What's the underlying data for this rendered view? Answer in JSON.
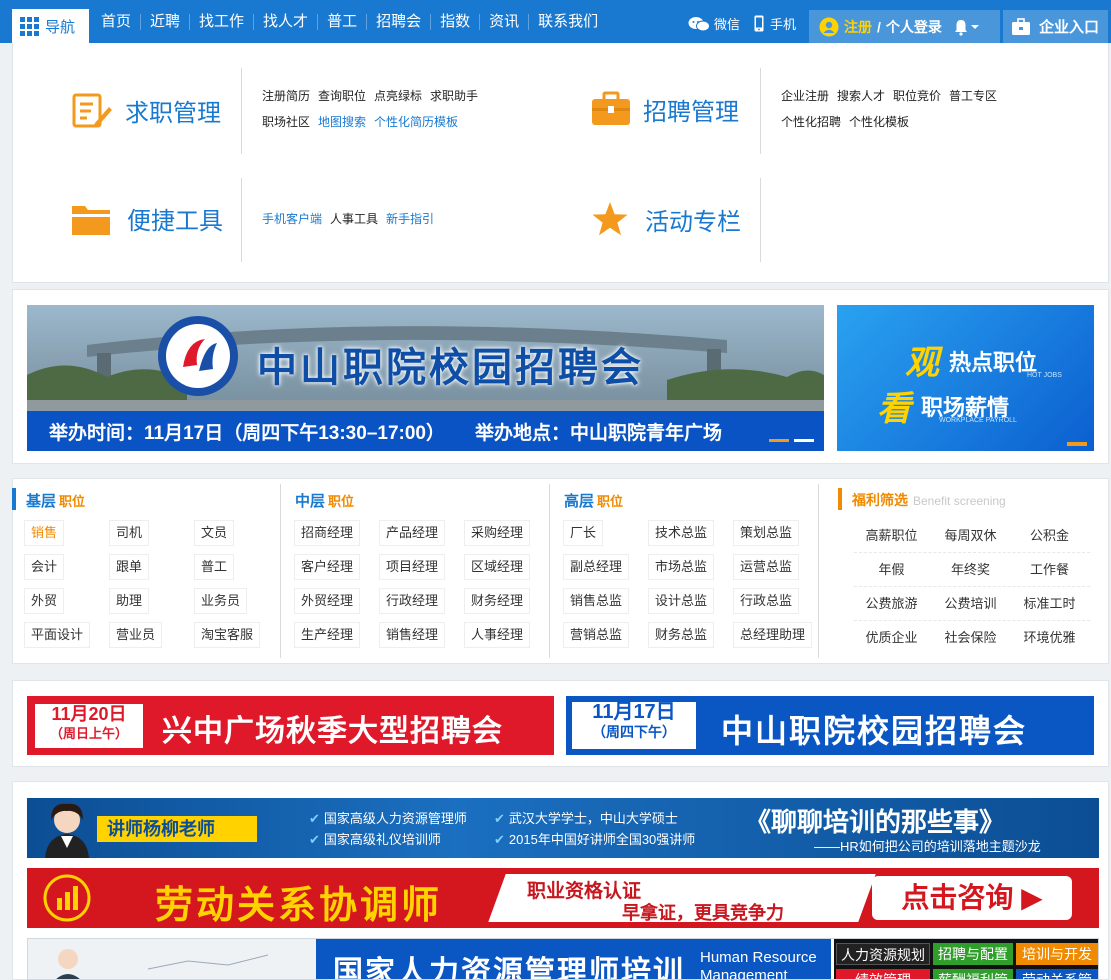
{
  "nav": {
    "menu_label": "导航",
    "items": [
      "首页",
      "近聘",
      "找工作",
      "找人才",
      "普工",
      "招聘会",
      "指数",
      "资讯",
      "联系我们"
    ],
    "wechat": "微信",
    "mobile": "手机",
    "register": "注册",
    "sep": "/",
    "login": "个人登录",
    "enterprise": "企业入口"
  },
  "panel": {
    "job_mgmt": {
      "title": "求职管理",
      "links_row1": [
        "注册简历",
        "查询职位",
        "点亮绿标",
        "求职助手"
      ],
      "links_row2": [
        "职场社区",
        "地图搜索",
        "个性化简历模板"
      ]
    },
    "recruit_mgmt": {
      "title": "招聘管理",
      "links_row1": [
        "企业注册",
        "搜索人才",
        "职位竞价",
        "普工专区"
      ],
      "links_row2": [
        "个性化招聘",
        "个性化模板"
      ]
    },
    "tools": {
      "title": "便捷工具",
      "links": [
        "手机客户端",
        "人事工具",
        "新手指引"
      ]
    },
    "events": {
      "title": "活动专栏"
    }
  },
  "banner": {
    "title": "中山职院校园招聘会",
    "time": "举办时间：11月17日（周四下午13:30–17:00）",
    "place": "举办地点：中山职院青年广场",
    "hot_title": "热点职位",
    "hot_sub": "HOT JOBS",
    "hot_char": "观",
    "news_title": "职场薪情",
    "news_sub": "WORKPLACE PAYROLL",
    "news_char": "看"
  },
  "jobs": {
    "basic": {
      "title": "基层",
      "suffix": "职位",
      "items": [
        "销售",
        "司机",
        "文员",
        "会计",
        "跟单",
        "普工",
        "外贸",
        "助理",
        "业务员",
        "平面设计",
        "营业员",
        "淘宝客服"
      ]
    },
    "middle": {
      "title": "中层",
      "suffix": "职位",
      "items": [
        "招商经理",
        "产品经理",
        "采购经理",
        "客户经理",
        "项目经理",
        "区域经理",
        "外贸经理",
        "行政经理",
        "财务经理",
        "生产经理",
        "销售经理",
        "人事经理"
      ]
    },
    "senior": {
      "title": "高层",
      "suffix": "职位",
      "items": [
        "厂长",
        "技术总监",
        "策划总监",
        "副总经理",
        "市场总监",
        "运营总监",
        "销售总监",
        "设计总监",
        "行政总监",
        "营销总监",
        "财务总监",
        "总经理助理"
      ]
    },
    "benefits": {
      "title": "福利筛选",
      "subtitle": "Benefit screening",
      "items": [
        "高薪职位",
        "每周双休",
        "公积金",
        "年假",
        "年终奖",
        "工作餐",
        "公费旅游",
        "公费培训",
        "标准工时",
        "优质企业",
        "社会保险",
        "环境优雅"
      ]
    }
  },
  "ads": {
    "ad1_date": "11月20日",
    "ad1_day": "（周日上午）",
    "ad1_title": "兴中广场秋季大型招聘会",
    "ad2_date": "11月17日",
    "ad2_day": "（周四下午）",
    "ad2_title": "中山职院校园招聘会",
    "trainer_name": "讲师杨柳老师",
    "trainer_q1": "国家高级人力资源管理师",
    "trainer_q2": "国家高级礼仪培训师",
    "trainer_q3": "武汉大学学士，中山大学硕士",
    "trainer_q4": "2015年中国好讲师全国30强讲师",
    "trainer_title": "《聊聊培训的那些事》",
    "trainer_sub": "——HR如何把公司的培训落地主题沙龙",
    "labor_title": "劳动关系协调师",
    "labor_slogan1": "职业资格认证",
    "labor_slogan2": "早拿证，更具竞争力",
    "labor_btn": "点击咨询 ▶",
    "hr_title": "国家人力资源管理师培训",
    "hr_en": "Human Resource Management",
    "hr_tags": [
      "人力资源规划",
      "招聘与配置",
      "培训与开发",
      "绩效管理",
      "薪酬福利管理",
      "劳动关系管理"
    ]
  },
  "colors": {
    "brand": "#1979d0",
    "accent": "#f08a00",
    "red": "#e0192a"
  }
}
